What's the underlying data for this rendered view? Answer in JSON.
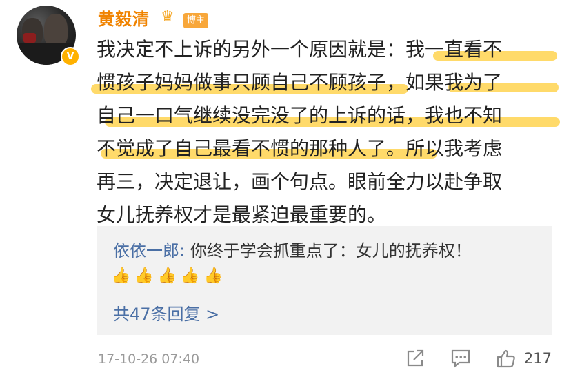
{
  "post": {
    "author": "黄毅清",
    "author_tag": "博主",
    "verified_badge": "V",
    "lines": [
      "我决定不上诉的另外一个原因就是：我一直看不",
      "惯孩子妈妈做事只顾自己不顾孩子，如果我为了",
      "自己一口气继续没完没了的上诉的话，我也不知",
      "不觉成了自己最看不惯的那种人了。所以我考虑",
      "再三，决定退让，画个句点。眼前全力以赴争取",
      "女儿抚养权才是最紧迫最重要的。"
    ],
    "highlight_color": "#FFD040"
  },
  "reply": {
    "user": "依依一郎",
    "separator": ": ",
    "text": "你终于学会抓重点了：女儿的抚养权！",
    "emojis": "👍👍👍👍👍",
    "more_label": "共47条回复 >"
  },
  "footer": {
    "timestamp": "17-10-26 07:40",
    "like_count": "217",
    "icons": [
      "share-icon",
      "comment-icon",
      "like-icon"
    ]
  },
  "colors": {
    "author": "#F08300",
    "link": "#4A6FA5",
    "reply_bg": "#F2F2F2"
  }
}
